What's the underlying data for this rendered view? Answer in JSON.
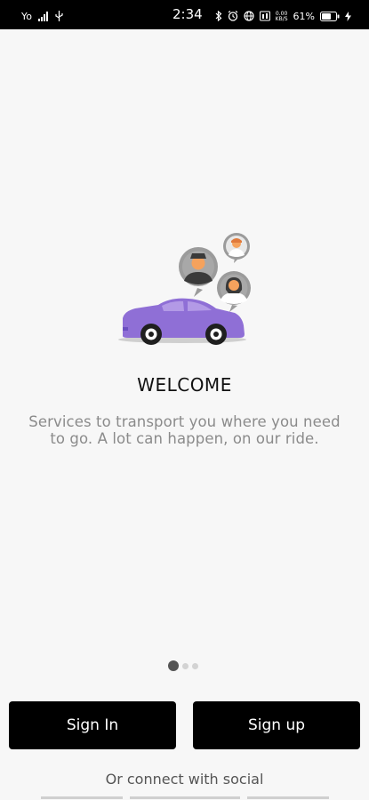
{
  "status_bar": {
    "network_label": "Yo",
    "time": "2:34",
    "speed_top": "0.00",
    "speed_bottom": "KB/S",
    "battery_percent": "61%"
  },
  "welcome": {
    "title": "WELCOME",
    "description_line1": "Services to transport you where you need",
    "description_line2": "to go. A lot can happen, on our ride."
  },
  "pager": {
    "total": 3,
    "active_index": 0
  },
  "actions": {
    "sign_in": "Sign In",
    "sign_up": "Sign up",
    "social_prompt": "Or connect with social"
  },
  "colors": {
    "car": "#8f6fd6",
    "button_bg": "#000000",
    "status_bar_bg": "#000000",
    "background": "#f7f7f7"
  }
}
